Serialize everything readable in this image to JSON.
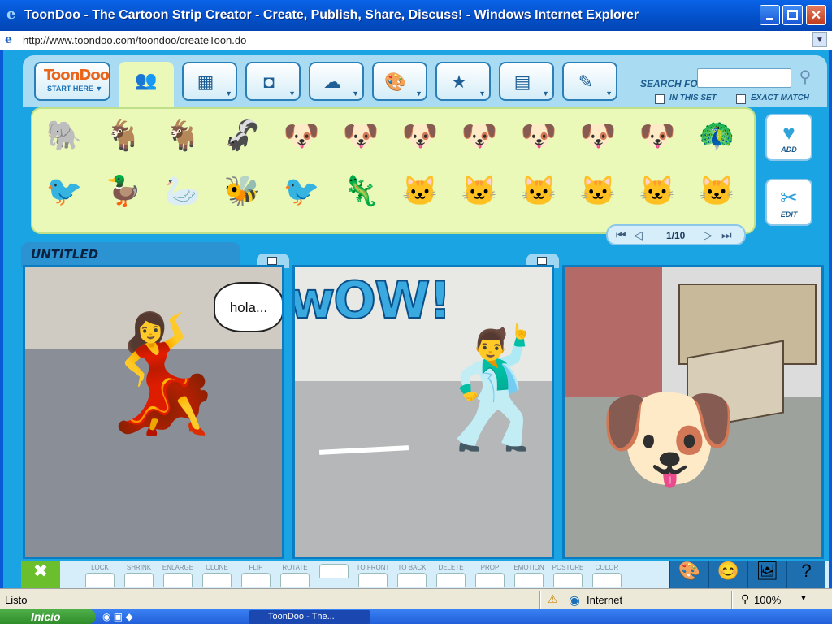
{
  "window": {
    "title": "ToonDoo - The Cartoon Strip Creator - Create, Publish, Share, Discuss! - Windows Internet Explorer",
    "url": "http://www.toondoo.com/toondoo/createToon.do"
  },
  "toolbar": {
    "start": {
      "logo": "ToonDoo",
      "label": "START HERE ▼"
    },
    "tabs": [
      {
        "name": "characters",
        "icon": "👥"
      },
      {
        "name": "backgrounds",
        "icon": "▦"
      },
      {
        "name": "props",
        "icon": "◘"
      },
      {
        "name": "speech-bubbles",
        "icon": "☁"
      },
      {
        "name": "special-effects",
        "icon": "🎨"
      },
      {
        "name": "favorites",
        "icon": "★"
      },
      {
        "name": "scenes",
        "icon": "▤"
      },
      {
        "name": "doodle",
        "icon": "✎"
      }
    ],
    "search_label": "SEARCH FOR",
    "search_value": "",
    "in_this_set": "IN THIS SET",
    "exact_match": "EXACT MATCH"
  },
  "palette": {
    "row1": [
      "🐘",
      "🐐",
      "🐐",
      "🦨",
      "🐶",
      "🐶",
      "🐶",
      "🐶",
      "🐶",
      "🐶",
      "🐶",
      "🦚"
    ],
    "row2": [
      "🐦",
      "🦆",
      "🦢",
      "🐝",
      "🐦",
      "🦎",
      "🐱",
      "🐱",
      "🐱",
      "🐱",
      "🐱",
      "🐱"
    ],
    "add_label": "ADD",
    "edit_label": "EDIT",
    "page": "1/10"
  },
  "strip": {
    "title": "UNTITLED",
    "panel1_bubble": "hola...",
    "panel2_text": "wOW!"
  },
  "tools": {
    "labels": [
      "LOCK",
      "SHRINK",
      "ENLARGE",
      "CLONE",
      "FLIP",
      "ROTATE",
      "",
      "TO FRONT",
      "TO BACK",
      "DELETE",
      "PROP",
      "EMOTION",
      "POSTURE",
      "COLOR"
    ]
  },
  "status": {
    "text": "Listo",
    "zone": "Internet",
    "zoom": "100%"
  },
  "taskbar": {
    "start": "Inicio",
    "item": "ToonDoo - The..."
  },
  "colors": {
    "accent": "#1aa4e3",
    "palette_bg": "#eaf8b8",
    "title_bar": "#0350c8"
  }
}
